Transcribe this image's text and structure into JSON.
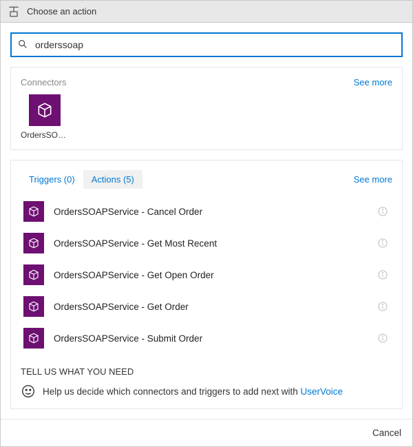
{
  "header": {
    "title": "Choose an action"
  },
  "search": {
    "value": "orderssoap"
  },
  "connectors": {
    "title": "Connectors",
    "see_more": "See more",
    "items": [
      {
        "label": "OrdersSOA..."
      }
    ]
  },
  "tabs": {
    "triggers": "Triggers (0)",
    "actions": "Actions (5)",
    "see_more": "See more"
  },
  "actions": [
    {
      "label": "OrdersSOAPService - Cancel Order"
    },
    {
      "label": "OrdersSOAPService - Get Most Recent"
    },
    {
      "label": "OrdersSOAPService - Get Open Order"
    },
    {
      "label": "OrdersSOAPService - Get Order"
    },
    {
      "label": "OrdersSOAPService - Submit Order"
    }
  ],
  "tell_us": {
    "title": "TELL US WHAT YOU NEED",
    "text": "Help us decide which connectors and triggers to add next with ",
    "link": "UserVoice"
  },
  "footer": {
    "cancel": "Cancel"
  }
}
